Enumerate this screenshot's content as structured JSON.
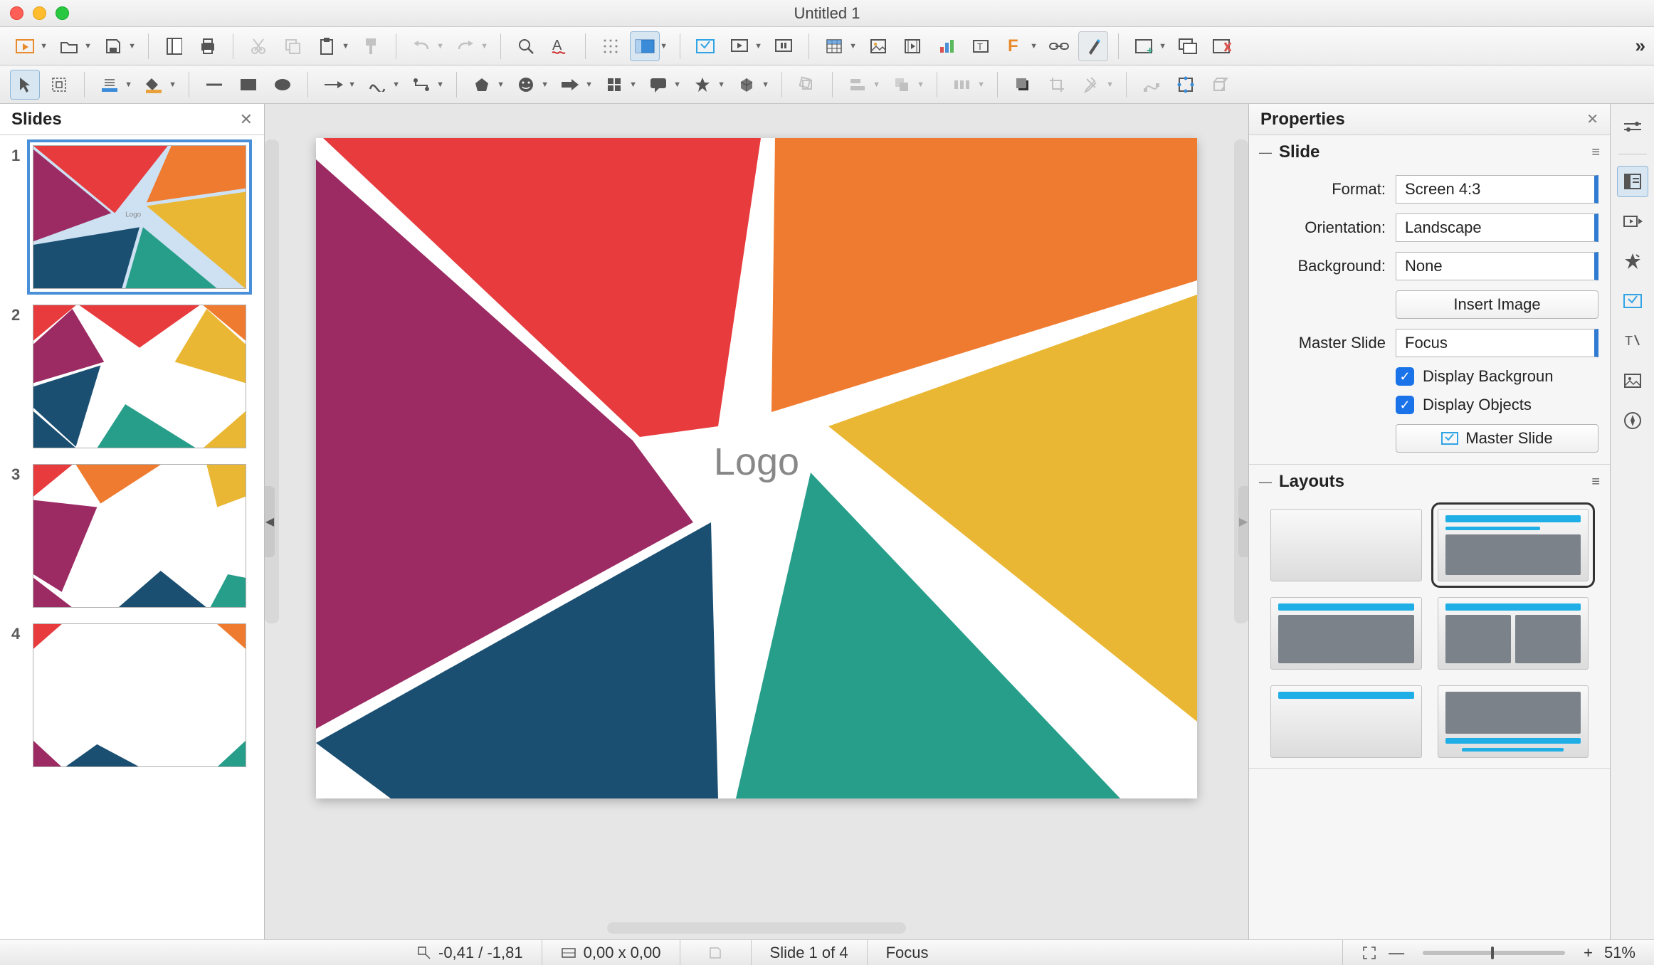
{
  "window": {
    "title": "Untitled 1"
  },
  "panels": {
    "slides_title": "Slides",
    "properties_title": "Properties"
  },
  "slides": [
    {
      "num": "1",
      "selected": true
    },
    {
      "num": "2",
      "selected": false
    },
    {
      "num": "3",
      "selected": false
    },
    {
      "num": "4",
      "selected": false
    }
  ],
  "canvas": {
    "center_text": "Logo"
  },
  "properties": {
    "slide_section": "Slide",
    "format_label": "Format:",
    "format_value": "Screen 4:3",
    "orientation_label": "Orientation:",
    "orientation_value": "Landscape",
    "background_label": "Background:",
    "background_value": "None",
    "insert_image": "Insert Image",
    "master_label": "Master Slide",
    "master_value": "Focus",
    "display_bg": "Display Backgroun",
    "display_obj": "Display Objects",
    "master_button": "Master Slide",
    "layouts_section": "Layouts"
  },
  "statusbar": {
    "coords": "-0,41 / -1,81",
    "size": "0,00 x 0,00",
    "slide": "Slide 1 of 4",
    "master": "Focus",
    "zoom": "51%"
  },
  "colors": {
    "red": "#e73b3e",
    "orange": "#ef7b30",
    "yellow": "#eab735",
    "teal": "#279e8a",
    "navy": "#1a4f72",
    "plum": "#9c2a63"
  }
}
